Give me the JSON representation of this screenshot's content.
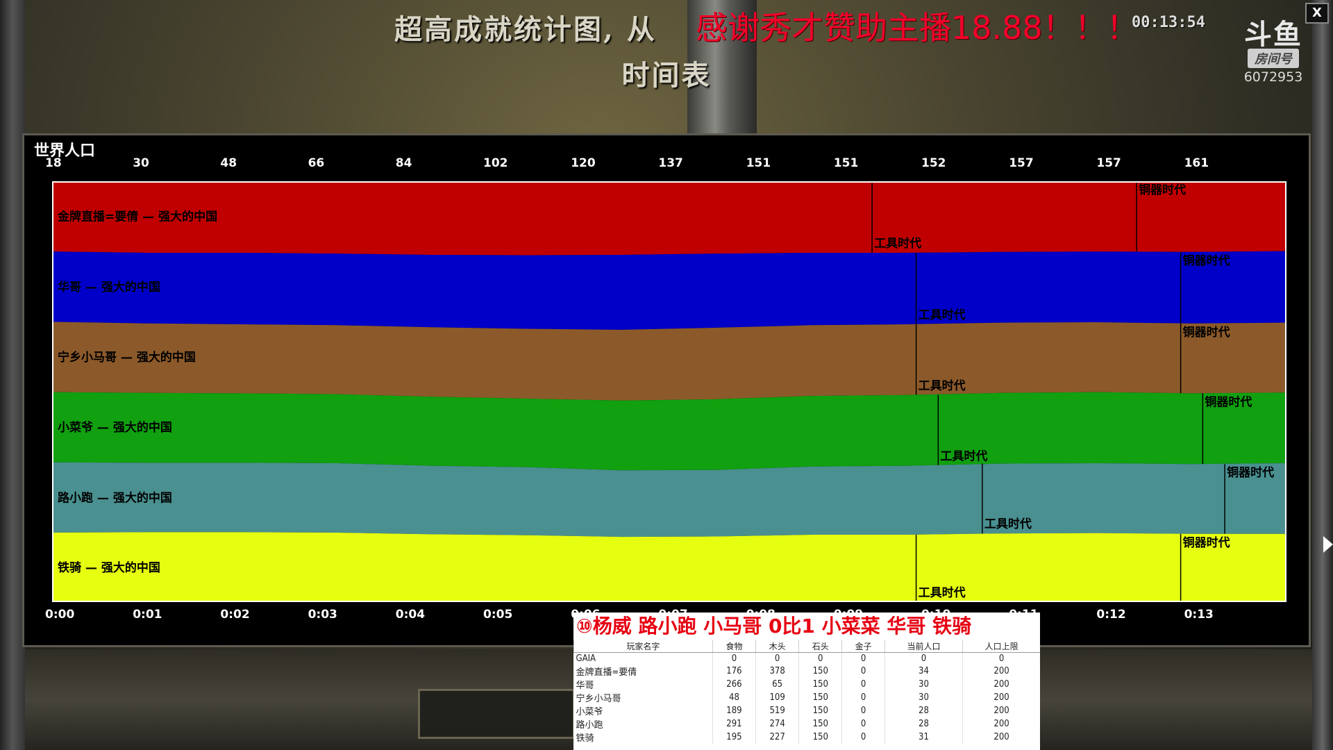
{
  "screen": {
    "title_main": "超高成就统计图, 从",
    "title_sub": "时间表",
    "overlay_text": "感谢秀才赞助主播18.88！！！",
    "clock": "00:13:54",
    "close_label": "X"
  },
  "stream_logo": {
    "mark": "斗鱼",
    "room_label": "房间号",
    "room_number": "6072953"
  },
  "chart_panel": {
    "title": "世界人口",
    "population_ticks": [
      "18",
      "30",
      "48",
      "66",
      "84",
      "102",
      "120",
      "137",
      "151",
      "151",
      "152",
      "157",
      "157",
      "161"
    ],
    "time_ticks": [
      "0:00",
      "0:01",
      "0:02",
      "0:03",
      "0:04",
      "0:05",
      "0:06",
      "0:07",
      "0:08",
      "0:09",
      "0:10",
      "0:11",
      "0:12",
      "0:13"
    ]
  },
  "chart_data": {
    "type": "area",
    "title": "世界人口",
    "x_unit": "minutes",
    "xlim": [
      0,
      14
    ],
    "series": [
      {
        "name": "金牌直播=要倩 — 强大的中国",
        "color": "#c00000",
        "share": [
          0.167,
          0.17,
          0.17,
          0.172,
          0.175,
          0.176,
          0.175,
          0.172,
          0.17,
          0.17,
          0.168,
          0.167,
          0.168,
          0.166
        ],
        "age_ups": [
          {
            "label": "工具时代",
            "time": 9.3
          },
          {
            "label": "铜器时代",
            "time": 12.3
          }
        ]
      },
      {
        "name": "华哥 — 强大的中国",
        "color": "#0000c8",
        "share": [
          0.167,
          0.168,
          0.17,
          0.17,
          0.172,
          0.175,
          0.178,
          0.176,
          0.172,
          0.17,
          0.168,
          0.168,
          0.17,
          0.17
        ],
        "age_ups": [
          {
            "label": "工具时代",
            "time": 9.8
          },
          {
            "label": "铜器时代",
            "time": 12.8
          }
        ]
      },
      {
        "name": "宁乡小马哥 — 强大的中国",
        "color": "#8c5a2a",
        "share": [
          0.167,
          0.165,
          0.164,
          0.164,
          0.165,
          0.166,
          0.168,
          0.17,
          0.168,
          0.168,
          0.167,
          0.166,
          0.166,
          0.166
        ],
        "age_ups": [
          {
            "label": "工具时代",
            "time": 9.8
          },
          {
            "label": "铜器时代",
            "time": 12.8
          }
        ]
      },
      {
        "name": "小菜爷 — 强大的中国",
        "color": "#10a010",
        "share": [
          0.167,
          0.166,
          0.165,
          0.164,
          0.164,
          0.163,
          0.166,
          0.168,
          0.168,
          0.168,
          0.168,
          0.169,
          0.168,
          0.168
        ],
        "age_ups": [
          {
            "label": "工具时代",
            "time": 10.05
          },
          {
            "label": "铜器时代",
            "time": 13.05
          }
        ]
      },
      {
        "name": "路小跑 — 强大的中国",
        "color": "#4a9090",
        "share": [
          0.167,
          0.165,
          0.165,
          0.165,
          0.163,
          0.162,
          0.158,
          0.158,
          0.162,
          0.164,
          0.166,
          0.166,
          0.166,
          0.168
        ],
        "age_ups": [
          {
            "label": "工具时代",
            "time": 10.55
          },
          {
            "label": "铜器时代",
            "time": 13.3
          }
        ]
      },
      {
        "name": "铁骑 — 强大的中国",
        "color": "#e6ff10",
        "share": [
          0.165,
          0.166,
          0.166,
          0.165,
          0.161,
          0.159,
          0.155,
          0.156,
          0.16,
          0.16,
          0.163,
          0.164,
          0.162,
          0.162
        ],
        "age_ups": [
          {
            "label": "工具时代",
            "time": 9.8
          },
          {
            "label": "铜器时代",
            "time": 12.8
          }
        ]
      }
    ]
  },
  "stats_panel": {
    "header": "⑩杨威 路小跑 小马哥    0比1  小菜菜 华哥 铁骑",
    "columns": [
      "玩家名字",
      "食物",
      "木头",
      "石头",
      "金子",
      "当前人口",
      "人口上限"
    ],
    "rows": [
      [
        "GAIA",
        "0",
        "0",
        "0",
        "0",
        "0",
        "0"
      ],
      [
        "金牌直播=要倩",
        "176",
        "378",
        "150",
        "0",
        "34",
        "200"
      ],
      [
        "华哥",
        "266",
        "65",
        "150",
        "0",
        "30",
        "200"
      ],
      [
        "宁乡小马哥",
        "48",
        "109",
        "150",
        "0",
        "30",
        "200"
      ],
      [
        "小菜爷",
        "189",
        "519",
        "150",
        "0",
        "28",
        "200"
      ],
      [
        "路小跑",
        "291",
        "274",
        "150",
        "0",
        "28",
        "200"
      ],
      [
        "铁骑",
        "195",
        "227",
        "150",
        "0",
        "31",
        "200"
      ]
    ]
  }
}
